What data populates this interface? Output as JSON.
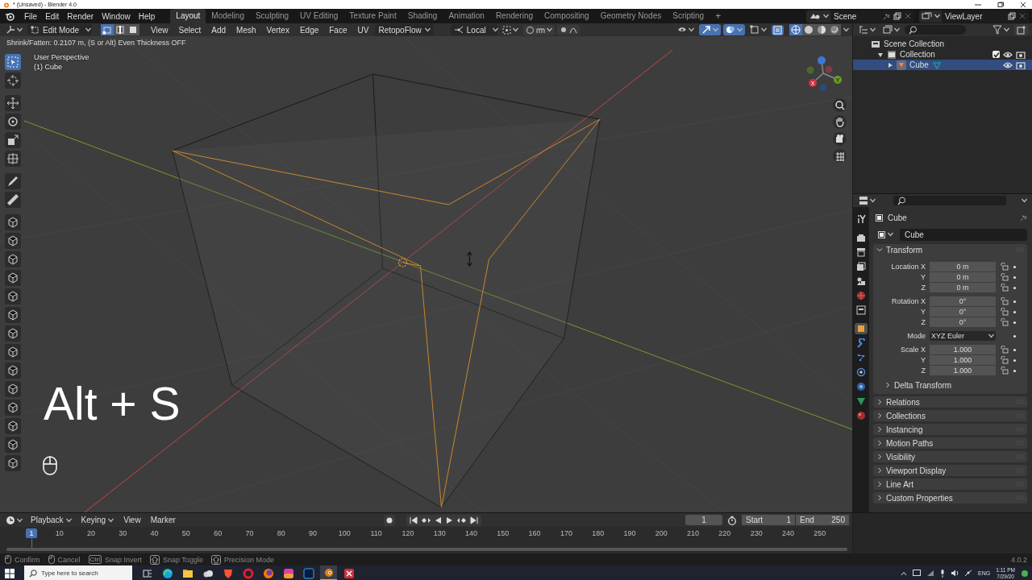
{
  "window": {
    "title": "* (Unsaved) - Blender 4.0"
  },
  "menu": [
    "File",
    "Edit",
    "Render",
    "Window",
    "Help"
  ],
  "workspaces": [
    {
      "label": "Layout",
      "selected": true
    },
    {
      "label": "Modeling",
      "selected": false
    },
    {
      "label": "Sculpting",
      "selected": false
    },
    {
      "label": "UV Editing",
      "selected": false
    },
    {
      "label": "Texture Paint",
      "selected": false
    },
    {
      "label": "Shading",
      "selected": false
    },
    {
      "label": "Animation",
      "selected": false
    },
    {
      "label": "Rendering",
      "selected": false
    },
    {
      "label": "Compositing",
      "selected": false
    },
    {
      "label": "Geometry Nodes",
      "selected": false
    },
    {
      "label": "Scripting",
      "selected": false
    }
  ],
  "add_workspace": "+",
  "scene": "Scene",
  "view_layer": "ViewLayer",
  "viewport": {
    "mode": "Edit Mode",
    "select_modes": [
      {
        "selected": true
      },
      {
        "selected": false
      },
      {
        "selected": false
      }
    ],
    "menus": [
      "View",
      "Select",
      "Add",
      "Mesh",
      "Vertex",
      "Edge",
      "Face",
      "UV"
    ],
    "addon_menu": "RetopoFlow",
    "orientation": "Local",
    "operator_hint": "Shrink/Fatten: 0.2107 m, (S or Alt) Even Thickness OFF",
    "view_name": "User Perspective",
    "object_label": "(1) Cube",
    "overlay_text": "Alt + S",
    "gizmo_labels": [
      "Y",
      "X"
    ],
    "tools": [
      {
        "selected": true
      },
      {
        "selected": false
      },
      {
        "selected": false
      },
      {
        "selected": false
      },
      {
        "selected": false
      },
      {
        "selected": false
      },
      {
        "selected": false
      },
      {
        "selected": false
      },
      {
        "selected": false
      },
      {
        "selected": false
      },
      {
        "selected": false
      },
      {
        "selected": false
      },
      {
        "selected": false
      },
      {
        "selected": false
      },
      {
        "selected": false
      },
      {
        "selected": false
      },
      {
        "selected": false
      },
      {
        "selected": false
      },
      {
        "selected": false
      },
      {
        "selected": false
      },
      {
        "selected": false
      },
      {
        "selected": false
      }
    ]
  },
  "outliner": {
    "tree": [
      {
        "label": "Scene Collection",
        "kind": "scene",
        "selected": false,
        "children": [
          {
            "label": "Collection",
            "kind": "collection",
            "selected": false,
            "expanded": true,
            "checked": true,
            "children": [
              {
                "label": "Cube",
                "kind": "object",
                "selected": true,
                "expanded": false
              }
            ]
          }
        ]
      }
    ]
  },
  "properties": {
    "tabs": [
      {
        "selected": false
      },
      {
        "selected": false
      },
      {
        "selected": false
      },
      {
        "selected": false
      },
      {
        "selected": false
      },
      {
        "selected": false
      },
      {
        "selected": false
      },
      {
        "selected": true
      },
      {
        "selected": false
      },
      {
        "selected": false
      },
      {
        "selected": false
      },
      {
        "selected": false
      },
      {
        "selected": false
      },
      {
        "selected": false
      }
    ],
    "object_name": "Cube",
    "name_field": "Cube",
    "transform": {
      "label": "Transform",
      "expanded": true,
      "rows": [
        {
          "label": "Location X",
          "value": "0 m",
          "kind": "number",
          "group_start": true
        },
        {
          "label": "Y",
          "value": "0 m",
          "kind": "number",
          "group_start": false
        },
        {
          "label": "Z",
          "value": "0 m",
          "kind": "number",
          "group_start": false
        },
        {
          "label": "Rotation X",
          "value": "0°",
          "kind": "number",
          "group_start": true
        },
        {
          "label": "Y",
          "value": "0°",
          "kind": "number",
          "group_start": false
        },
        {
          "label": "Z",
          "value": "0°",
          "kind": "number",
          "group_start": false
        },
        {
          "label": "Mode",
          "value": "XYZ Euler",
          "kind": "dropdown",
          "group_start": true
        },
        {
          "label": "Scale X",
          "value": "1.000",
          "kind": "number",
          "group_start": true
        },
        {
          "label": "Y",
          "value": "1.000",
          "kind": "number",
          "group_start": false
        },
        {
          "label": "Z",
          "value": "1.000",
          "kind": "number",
          "group_start": false
        }
      ],
      "subpanel": {
        "label": "Delta Transform",
        "expanded": false
      }
    },
    "panels": [
      {
        "label": "Relations",
        "expanded": false
      },
      {
        "label": "Collections",
        "expanded": false
      },
      {
        "label": "Instancing",
        "expanded": false
      },
      {
        "label": "Motion Paths",
        "expanded": false
      },
      {
        "label": "Visibility",
        "expanded": false
      },
      {
        "label": "Viewport Display",
        "expanded": false
      },
      {
        "label": "Line Art",
        "expanded": false
      },
      {
        "label": "Custom Properties",
        "expanded": false
      }
    ]
  },
  "timeline": {
    "menus": [
      {
        "label": "Playback",
        "has_caret": true
      },
      {
        "label": "Keying",
        "has_caret": true
      },
      {
        "label": "View",
        "has_caret": false
      },
      {
        "label": "Marker",
        "has_caret": false
      }
    ],
    "current_frame": "1",
    "frame_field": "1",
    "start_label": "Start",
    "start": "1",
    "end_label": "End",
    "end": "250",
    "ticks": [
      "10",
      "20",
      "30",
      "40",
      "50",
      "60",
      "70",
      "80",
      "90",
      "100",
      "110",
      "120",
      "130",
      "140",
      "150",
      "160",
      "170",
      "180",
      "190",
      "200",
      "210",
      "220",
      "230",
      "240",
      "250"
    ]
  },
  "status_bar": {
    "items": [
      {
        "kind": "mouse",
        "label": "Confirm"
      },
      {
        "kind": "mouse",
        "label": "Cancel"
      },
      {
        "kind": "key",
        "key": "Ctrl",
        "label": "Snap Invert"
      },
      {
        "kind": "shift",
        "label": "Snap Toggle"
      },
      {
        "kind": "shift",
        "label": "Precision Mode"
      }
    ],
    "version": "4.0.2"
  },
  "taskbar": {
    "search_placeholder": "Type here to search",
    "apps": [
      {
        "selected": false
      },
      {
        "selected": false
      },
      {
        "selected": false
      },
      {
        "selected": false
      },
      {
        "selected": false
      },
      {
        "selected": false
      },
      {
        "selected": false
      },
      {
        "selected": false
      },
      {
        "selected": false
      },
      {
        "selected": true
      },
      {
        "selected": false
      }
    ],
    "language": "ENG",
    "time": "1:11 PM",
    "date": "7/29/20"
  }
}
